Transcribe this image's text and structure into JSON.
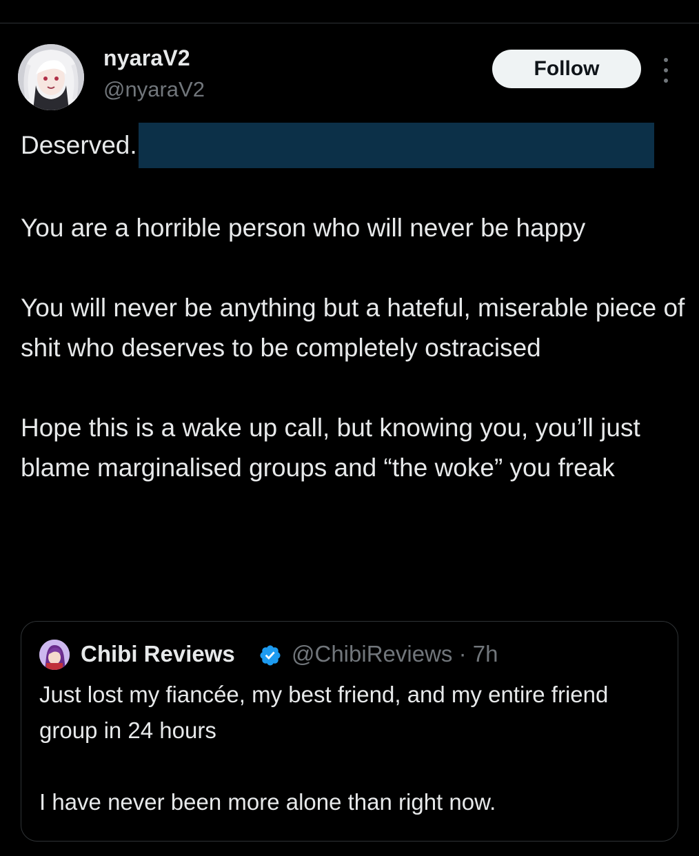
{
  "author": {
    "display_name": "nyaraV2",
    "handle": "@nyaraV2",
    "avatar_icon": "anime-girl-avatar"
  },
  "actions": {
    "follow_label": "Follow",
    "more_icon": "more-vertical-icon"
  },
  "tweet": {
    "first_line": "Deserved.",
    "redaction_color": "#0c3048",
    "paragraphs": [
      "You are a horrible person who will never be happy",
      "You will never be anything but a hateful, miserable piece of shit who deserves to be completely ostracised",
      "Hope this is a wake up call, but knowing you, you’ll just blame marginalised groups and “the woke” you freak"
    ]
  },
  "quoted": {
    "display_name": "Chibi Reviews",
    "verified": true,
    "verified_color": "#1d9bf0",
    "handle": "@ChibiReviews",
    "separator": "·",
    "time": "7h",
    "paragraphs": [
      "Just lost my fiancée, my best friend, and my entire friend group in 24 hours",
      "I have never been more alone than right now."
    ]
  },
  "colors": {
    "background": "#000000",
    "text": "#e7e9ea",
    "secondary_text": "#71767b",
    "border": "#2f3336",
    "follow_bg": "#eff3f4"
  }
}
